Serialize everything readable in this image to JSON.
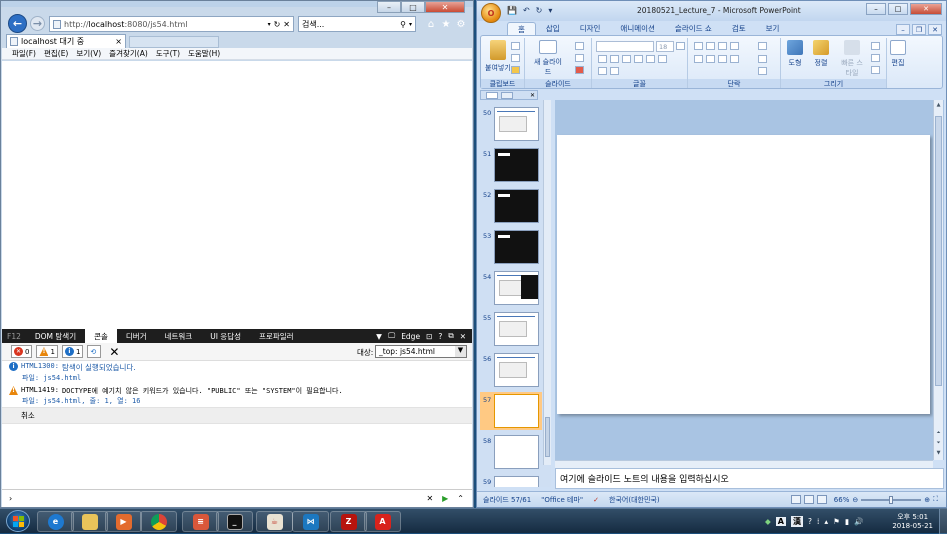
{
  "ie": {
    "url_prefix": "http://",
    "url_host": "localhost",
    "url_rest": ":8080/js54.html",
    "search_placeholder": "검색...",
    "tab_label": "localhost 대기 중",
    "tab_close": "×",
    "menu": [
      "파일(F)",
      "편집(E)",
      "보기(V)",
      "즐겨찾기(A)",
      "도구(T)",
      "도움말(H)"
    ]
  },
  "devtools": {
    "f12_label": "F12",
    "tabs": [
      "DOM 탐색기",
      "콘솔",
      "디버거",
      "네트워크",
      "UI 응답성",
      "프로파일러"
    ],
    "active_tab": "콘솔",
    "emulation_label": "Edge",
    "counts": {
      "errors": "0",
      "warnings": "1",
      "info": "1"
    },
    "target_label": "대상:",
    "target_value": "_top: js54.html",
    "messages": [
      {
        "code": "HTML1300:",
        "text": "탐색이 실행되었습니다.",
        "file": "파일: js54.html",
        "level": "info"
      },
      {
        "code": "HTML1419:",
        "text": "DOCTYPE에 예기치 않은 키워드가 있습니다. \"PUBLIC\" 또는 \"SYSTEM\"이 필요합니다.",
        "file": "파일: js54.html, 줄: 1, 열: 16",
        "level": "warning"
      }
    ],
    "cancel_text": "취소",
    "prompt": "›"
  },
  "powerpoint": {
    "title": "20180521_Lecture_7 - Microsoft PowerPoint",
    "office_btn": "O",
    "tabs": [
      "홈",
      "삽입",
      "디자인",
      "애니메이션",
      "슬라이드 쇼",
      "검토",
      "보기"
    ],
    "active_tab": "홈",
    "ribbon": {
      "groups": [
        "클립보드",
        "슬라이드",
        "글꼴",
        "단락",
        "그리기",
        "편집"
      ],
      "paste": "붙여넣기",
      "new_slide": "새 슬라이드",
      "font_size": "18",
      "shapes": "도형",
      "arrange": "정렬",
      "quick_styles": "빠른 스타일",
      "editing": "편집"
    },
    "thumbnails": [
      {
        "num": "50",
        "style": "white"
      },
      {
        "num": "51",
        "style": "dark"
      },
      {
        "num": "52",
        "style": "dark"
      },
      {
        "num": "53",
        "style": "dark"
      },
      {
        "num": "54",
        "style": "white-dark"
      },
      {
        "num": "55",
        "style": "white"
      },
      {
        "num": "56",
        "style": "white"
      },
      {
        "num": "57",
        "style": "blank",
        "selected": true
      },
      {
        "num": "58",
        "style": "blank"
      },
      {
        "num": "59",
        "style": "blank"
      }
    ],
    "notes_placeholder": "여기에 슬라이드 노트의 내용을 입력하십시오",
    "status": {
      "slide": "슬라이드 57/61",
      "theme": "\"Office 테마\"",
      "language": "한국어(대한민국)",
      "zoom": "66%"
    }
  },
  "taskbar": {
    "apps": [
      "ie",
      "explorer",
      "media-player",
      "chrome",
      "remote-app",
      "cmd",
      "java",
      "vscode",
      "filezilla",
      "acrobat"
    ],
    "tray_lang": "A",
    "tray_ime": "漢",
    "clock_line1": "오후 5:01",
    "clock_line2": "2018-05-21"
  },
  "colors": {
    "ie_chrome": "#c9d9ea",
    "office_ribbon": "#dbe8f8",
    "taskbar": "#152b41",
    "selected_slide": "#ffc983"
  }
}
